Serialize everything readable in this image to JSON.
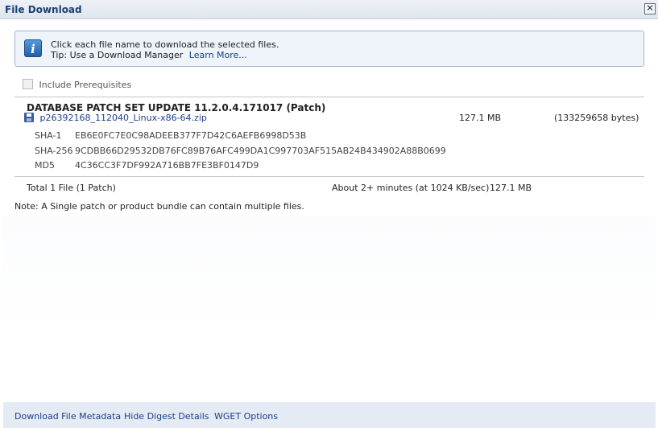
{
  "window": {
    "title": "File Download",
    "close_label": "✕"
  },
  "info": {
    "line1": "Click each file name to download the selected files.",
    "tip_text": "Tip: Use a Download Manager",
    "learn_more": "Learn More..."
  },
  "prerequisites": {
    "label": "Include Prerequisites",
    "checked": false
  },
  "patch": {
    "title": "DATABASE PATCH SET UPDATE 11.2.0.4.171017 (Patch)",
    "file_name": "p26392168_112040_Linux-x86-64.zip",
    "size": "127.1 MB",
    "bytes": "(133259658 bytes)",
    "digests": [
      {
        "label": "SHA-1",
        "value": "EB6E0FC7E0C98ADEEB377F7D42C6AEFB6998D53B"
      },
      {
        "label": "SHA-256",
        "value": "9CDBB66D29532DB76FC89B76AFC499DA1C997703AF515AB24B434902A88B0699"
      },
      {
        "label": "MD5",
        "value": "4C36CC3F7DF992A716BB7FE3BF0147D9"
      }
    ]
  },
  "total": {
    "label": "Total 1 File (1 Patch)",
    "time": "About 2+ minutes (at 1024 KB/sec)",
    "size": "127.1 MB"
  },
  "note": "Note: A Single patch or product bundle can contain multiple files.",
  "footer": {
    "metadata": "Download File Metadata",
    "hide_digest": "Hide Digest Details",
    "wget": "WGET Options"
  },
  "colors": {
    "link": "#1a3f8c",
    "title": "#1c3f73",
    "info_bg": "#eef4fa",
    "footer_bg": "#e4ebf4"
  },
  "icons": {
    "info": "info-icon",
    "file": "disk-icon",
    "close": "close-icon"
  }
}
